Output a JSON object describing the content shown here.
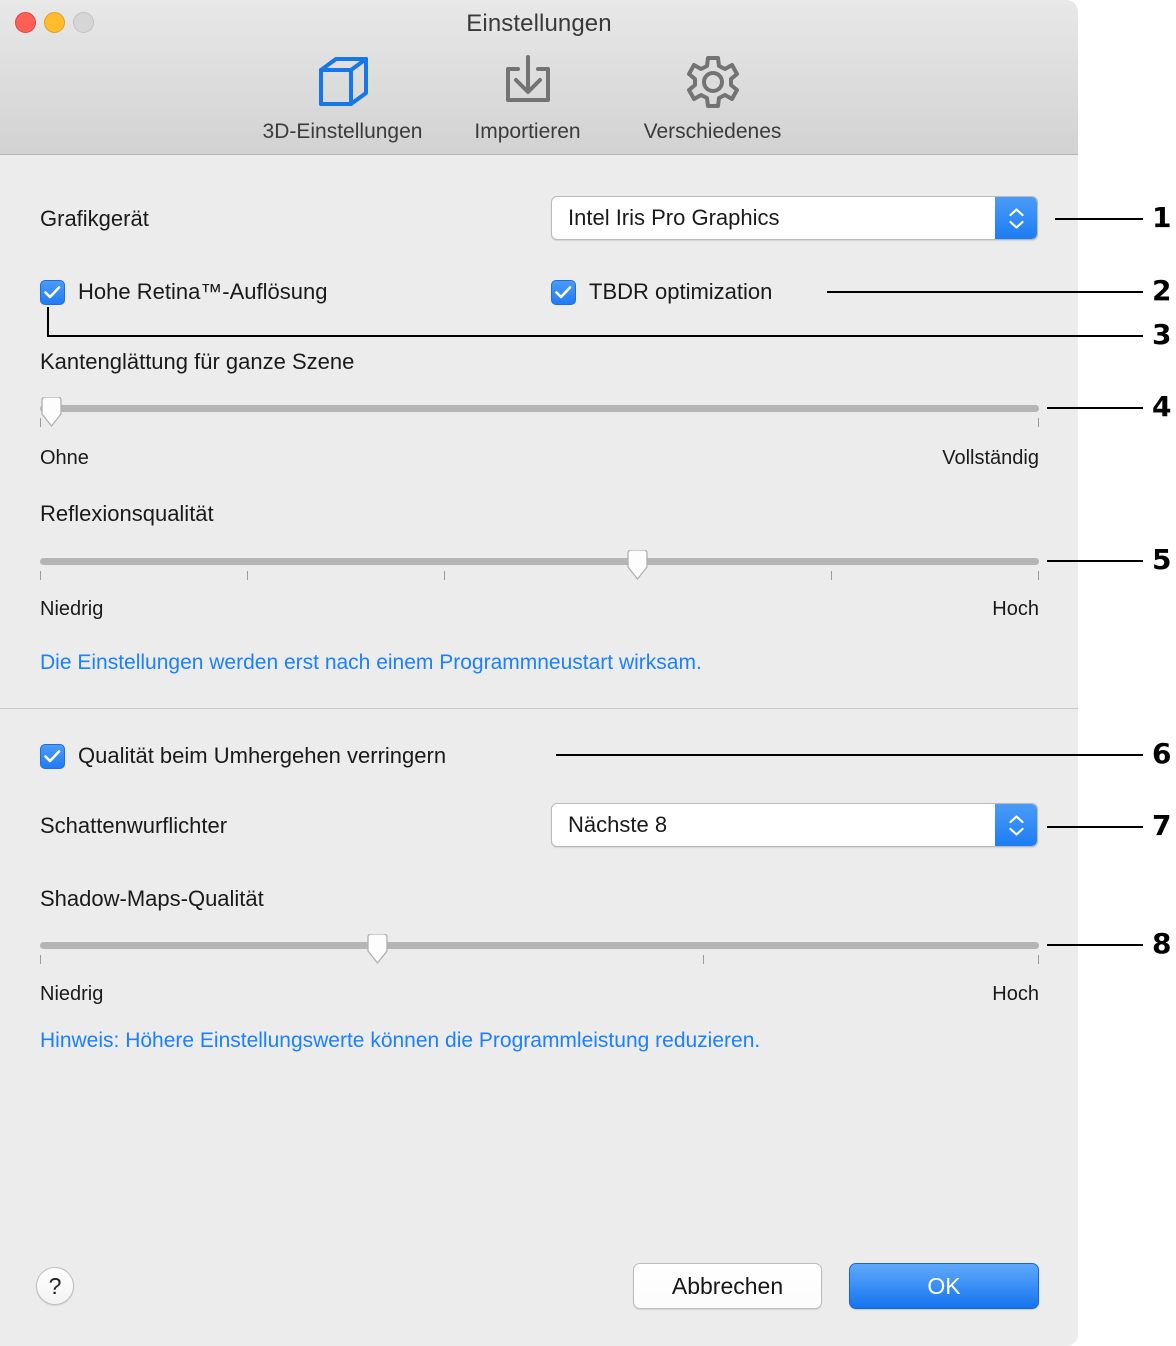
{
  "window": {
    "title": "Einstellungen",
    "traffic_lights": [
      "close-button",
      "minimize-button",
      "zoom-button"
    ]
  },
  "toolbar": {
    "items": [
      {
        "label": "3D-Einstellungen",
        "icon": "cube-icon",
        "selected": true
      },
      {
        "label": "Importieren",
        "icon": "import-tray-icon",
        "selected": false
      },
      {
        "label": "Verschiedenes",
        "icon": "gear-icon",
        "selected": false
      }
    ]
  },
  "section_3d": {
    "graphics_device": {
      "label": "Grafikgerät",
      "value": "Intel Iris Pro Graphics"
    },
    "retina_checkbox": {
      "label": "Hohe Retina™-Auflösung",
      "checked": true
    },
    "tbdr_checkbox": {
      "label": "TBDR optimization",
      "checked": true
    },
    "antialiasing": {
      "label": "Kantenglättung für ganze Szene",
      "min_label": "Ohne",
      "max_label": "Vollständig",
      "value_percent": 0,
      "ticks": 2
    },
    "reflection_quality": {
      "label": "Reflexionsqualität",
      "min_label": "Niedrig",
      "max_label": "Hoch",
      "value_percent": 60,
      "ticks": 5
    },
    "restart_note": "Die Einstellungen werden erst nach einem Programmneustart wirksam."
  },
  "section_shadows": {
    "reduce_quality_checkbox": {
      "label": "Qualität beim Umhergehen verringern",
      "checked": true
    },
    "shadow_casting_lights": {
      "label": "Schattenwurflichter",
      "value": "Nächste 8"
    },
    "shadow_map_quality": {
      "label": "Shadow-Maps-Qualität",
      "min_label": "Niedrig",
      "max_label": "Hoch",
      "value_percent": 33,
      "ticks": 3
    },
    "performance_note": "Hinweis: Höhere Einstellungswerte können die Programmleistung reduzieren."
  },
  "footer": {
    "help_label": "?",
    "cancel_label": "Abbrechen",
    "ok_label": "OK"
  },
  "callouts": [
    {
      "number": "1"
    },
    {
      "number": "2"
    },
    {
      "number": "3"
    },
    {
      "number": "4"
    },
    {
      "number": "5"
    },
    {
      "number": "6"
    },
    {
      "number": "7"
    },
    {
      "number": "8"
    }
  ],
  "colors": {
    "accent_blue": "#1d7df4",
    "note_blue": "#1a80ff",
    "window_bg": "#ececec",
    "titlebar_bg": "#dcdcdc",
    "track_gray": "#b5b5b5"
  }
}
